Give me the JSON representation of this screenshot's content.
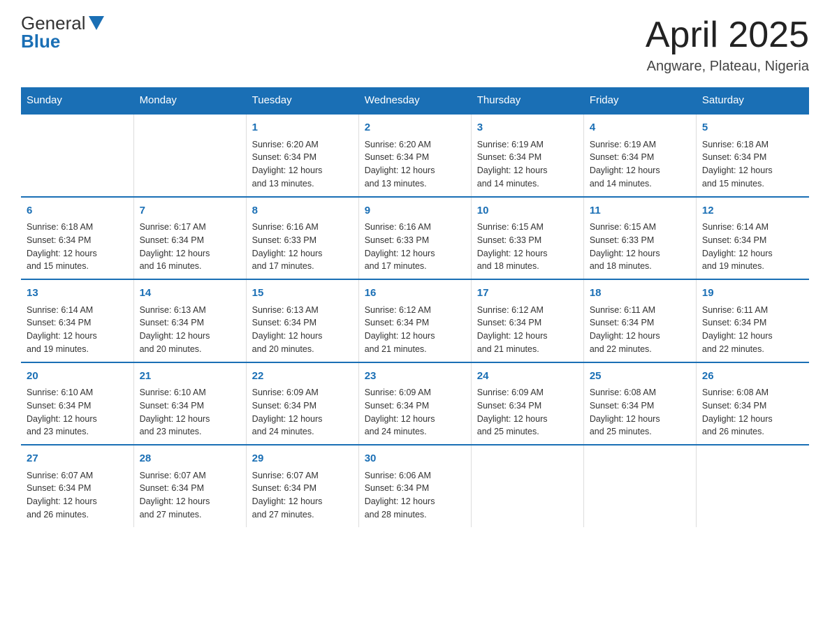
{
  "header": {
    "logo_line1": "General",
    "logo_line2": "Blue",
    "title": "April 2025",
    "subtitle": "Angware, Plateau, Nigeria"
  },
  "weekdays": [
    "Sunday",
    "Monday",
    "Tuesday",
    "Wednesday",
    "Thursday",
    "Friday",
    "Saturday"
  ],
  "weeks": [
    [
      {
        "day": "",
        "info": ""
      },
      {
        "day": "",
        "info": ""
      },
      {
        "day": "1",
        "info": "Sunrise: 6:20 AM\nSunset: 6:34 PM\nDaylight: 12 hours\nand 13 minutes."
      },
      {
        "day": "2",
        "info": "Sunrise: 6:20 AM\nSunset: 6:34 PM\nDaylight: 12 hours\nand 13 minutes."
      },
      {
        "day": "3",
        "info": "Sunrise: 6:19 AM\nSunset: 6:34 PM\nDaylight: 12 hours\nand 14 minutes."
      },
      {
        "day": "4",
        "info": "Sunrise: 6:19 AM\nSunset: 6:34 PM\nDaylight: 12 hours\nand 14 minutes."
      },
      {
        "day": "5",
        "info": "Sunrise: 6:18 AM\nSunset: 6:34 PM\nDaylight: 12 hours\nand 15 minutes."
      }
    ],
    [
      {
        "day": "6",
        "info": "Sunrise: 6:18 AM\nSunset: 6:34 PM\nDaylight: 12 hours\nand 15 minutes."
      },
      {
        "day": "7",
        "info": "Sunrise: 6:17 AM\nSunset: 6:34 PM\nDaylight: 12 hours\nand 16 minutes."
      },
      {
        "day": "8",
        "info": "Sunrise: 6:16 AM\nSunset: 6:33 PM\nDaylight: 12 hours\nand 17 minutes."
      },
      {
        "day": "9",
        "info": "Sunrise: 6:16 AM\nSunset: 6:33 PM\nDaylight: 12 hours\nand 17 minutes."
      },
      {
        "day": "10",
        "info": "Sunrise: 6:15 AM\nSunset: 6:33 PM\nDaylight: 12 hours\nand 18 minutes."
      },
      {
        "day": "11",
        "info": "Sunrise: 6:15 AM\nSunset: 6:33 PM\nDaylight: 12 hours\nand 18 minutes."
      },
      {
        "day": "12",
        "info": "Sunrise: 6:14 AM\nSunset: 6:34 PM\nDaylight: 12 hours\nand 19 minutes."
      }
    ],
    [
      {
        "day": "13",
        "info": "Sunrise: 6:14 AM\nSunset: 6:34 PM\nDaylight: 12 hours\nand 19 minutes."
      },
      {
        "day": "14",
        "info": "Sunrise: 6:13 AM\nSunset: 6:34 PM\nDaylight: 12 hours\nand 20 minutes."
      },
      {
        "day": "15",
        "info": "Sunrise: 6:13 AM\nSunset: 6:34 PM\nDaylight: 12 hours\nand 20 minutes."
      },
      {
        "day": "16",
        "info": "Sunrise: 6:12 AM\nSunset: 6:34 PM\nDaylight: 12 hours\nand 21 minutes."
      },
      {
        "day": "17",
        "info": "Sunrise: 6:12 AM\nSunset: 6:34 PM\nDaylight: 12 hours\nand 21 minutes."
      },
      {
        "day": "18",
        "info": "Sunrise: 6:11 AM\nSunset: 6:34 PM\nDaylight: 12 hours\nand 22 minutes."
      },
      {
        "day": "19",
        "info": "Sunrise: 6:11 AM\nSunset: 6:34 PM\nDaylight: 12 hours\nand 22 minutes."
      }
    ],
    [
      {
        "day": "20",
        "info": "Sunrise: 6:10 AM\nSunset: 6:34 PM\nDaylight: 12 hours\nand 23 minutes."
      },
      {
        "day": "21",
        "info": "Sunrise: 6:10 AM\nSunset: 6:34 PM\nDaylight: 12 hours\nand 23 minutes."
      },
      {
        "day": "22",
        "info": "Sunrise: 6:09 AM\nSunset: 6:34 PM\nDaylight: 12 hours\nand 24 minutes."
      },
      {
        "day": "23",
        "info": "Sunrise: 6:09 AM\nSunset: 6:34 PM\nDaylight: 12 hours\nand 24 minutes."
      },
      {
        "day": "24",
        "info": "Sunrise: 6:09 AM\nSunset: 6:34 PM\nDaylight: 12 hours\nand 25 minutes."
      },
      {
        "day": "25",
        "info": "Sunrise: 6:08 AM\nSunset: 6:34 PM\nDaylight: 12 hours\nand 25 minutes."
      },
      {
        "day": "26",
        "info": "Sunrise: 6:08 AM\nSunset: 6:34 PM\nDaylight: 12 hours\nand 26 minutes."
      }
    ],
    [
      {
        "day": "27",
        "info": "Sunrise: 6:07 AM\nSunset: 6:34 PM\nDaylight: 12 hours\nand 26 minutes."
      },
      {
        "day": "28",
        "info": "Sunrise: 6:07 AM\nSunset: 6:34 PM\nDaylight: 12 hours\nand 27 minutes."
      },
      {
        "day": "29",
        "info": "Sunrise: 6:07 AM\nSunset: 6:34 PM\nDaylight: 12 hours\nand 27 minutes."
      },
      {
        "day": "30",
        "info": "Sunrise: 6:06 AM\nSunset: 6:34 PM\nDaylight: 12 hours\nand 28 minutes."
      },
      {
        "day": "",
        "info": ""
      },
      {
        "day": "",
        "info": ""
      },
      {
        "day": "",
        "info": ""
      }
    ]
  ]
}
